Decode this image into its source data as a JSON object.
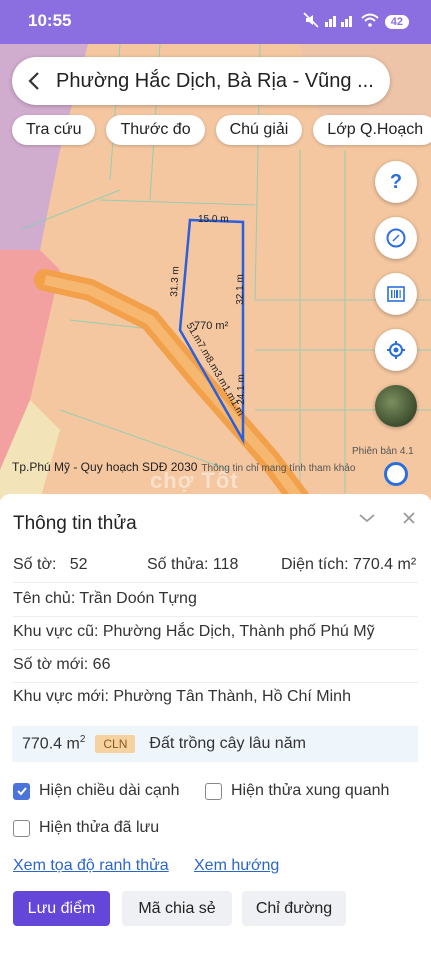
{
  "status_bar": {
    "time": "10:55",
    "extra": "⋯",
    "battery": "42"
  },
  "search": {
    "title": "Phường Hắc Dịch, Bà Rịa - Vũng ..."
  },
  "chips": [
    "Tra cứu",
    "Thước đo",
    "Chú giải",
    "Lớp Q.Hoạch"
  ],
  "map": {
    "edge_top": "15.0 m",
    "edge_left": "31.3 m",
    "edge_right": "32.1 m",
    "edge_right_lower": "24.1 m",
    "edge_bottom": "51.m7.m8.m3.m1.m1.m",
    "area": "770 m²",
    "version": "Phiên bản 4.1",
    "footer": "Tp.Phú Mỹ - Quy hoạch SDĐ 2030",
    "footer_note": "Thông tin chỉ mang tính tham khảo",
    "watermark": "chợ Tốt",
    "colors": {
      "land": "#f4c7a0",
      "road": "#f2a04a",
      "zone_purple": "#c9a7d6",
      "zone_red": "#f2a0a0"
    }
  },
  "sheet": {
    "title": "Thông tin thửa",
    "so_to": "Số tờ:   52",
    "so_thua": "Số thửa: 118",
    "dien_tich": "Diện tích: 770.4 m²",
    "ten_chu": "Tên chủ: Trần Doón Tựng",
    "khu_vuc_cu": "Khu vực cũ: Phường Hắc Dịch, Thành phố Phú Mỹ",
    "so_to_moi": "Số tờ mới: 66",
    "khu_vuc_moi": "Khu vực mới: Phường Tân Thành, Hồ Chí Minh",
    "landuse_area": "770.4 m",
    "landuse_area_sup": "2",
    "landuse_code": "CLN",
    "landuse_type": "Đất trồng cây lâu năm",
    "check_edge_length": "Hiện chiều dài cạnh",
    "check_neighbors": "Hiện thửa xung quanh",
    "check_saved": "Hiện thửa đã lưu",
    "link_coords": "Xem tọa độ ranh thửa",
    "link_direction": "Xem hướng",
    "btn_save": "Lưu điểm",
    "btn_share": "Mã chia sẻ",
    "btn_directions": "Chỉ đường"
  },
  "accent": "#6446d8"
}
